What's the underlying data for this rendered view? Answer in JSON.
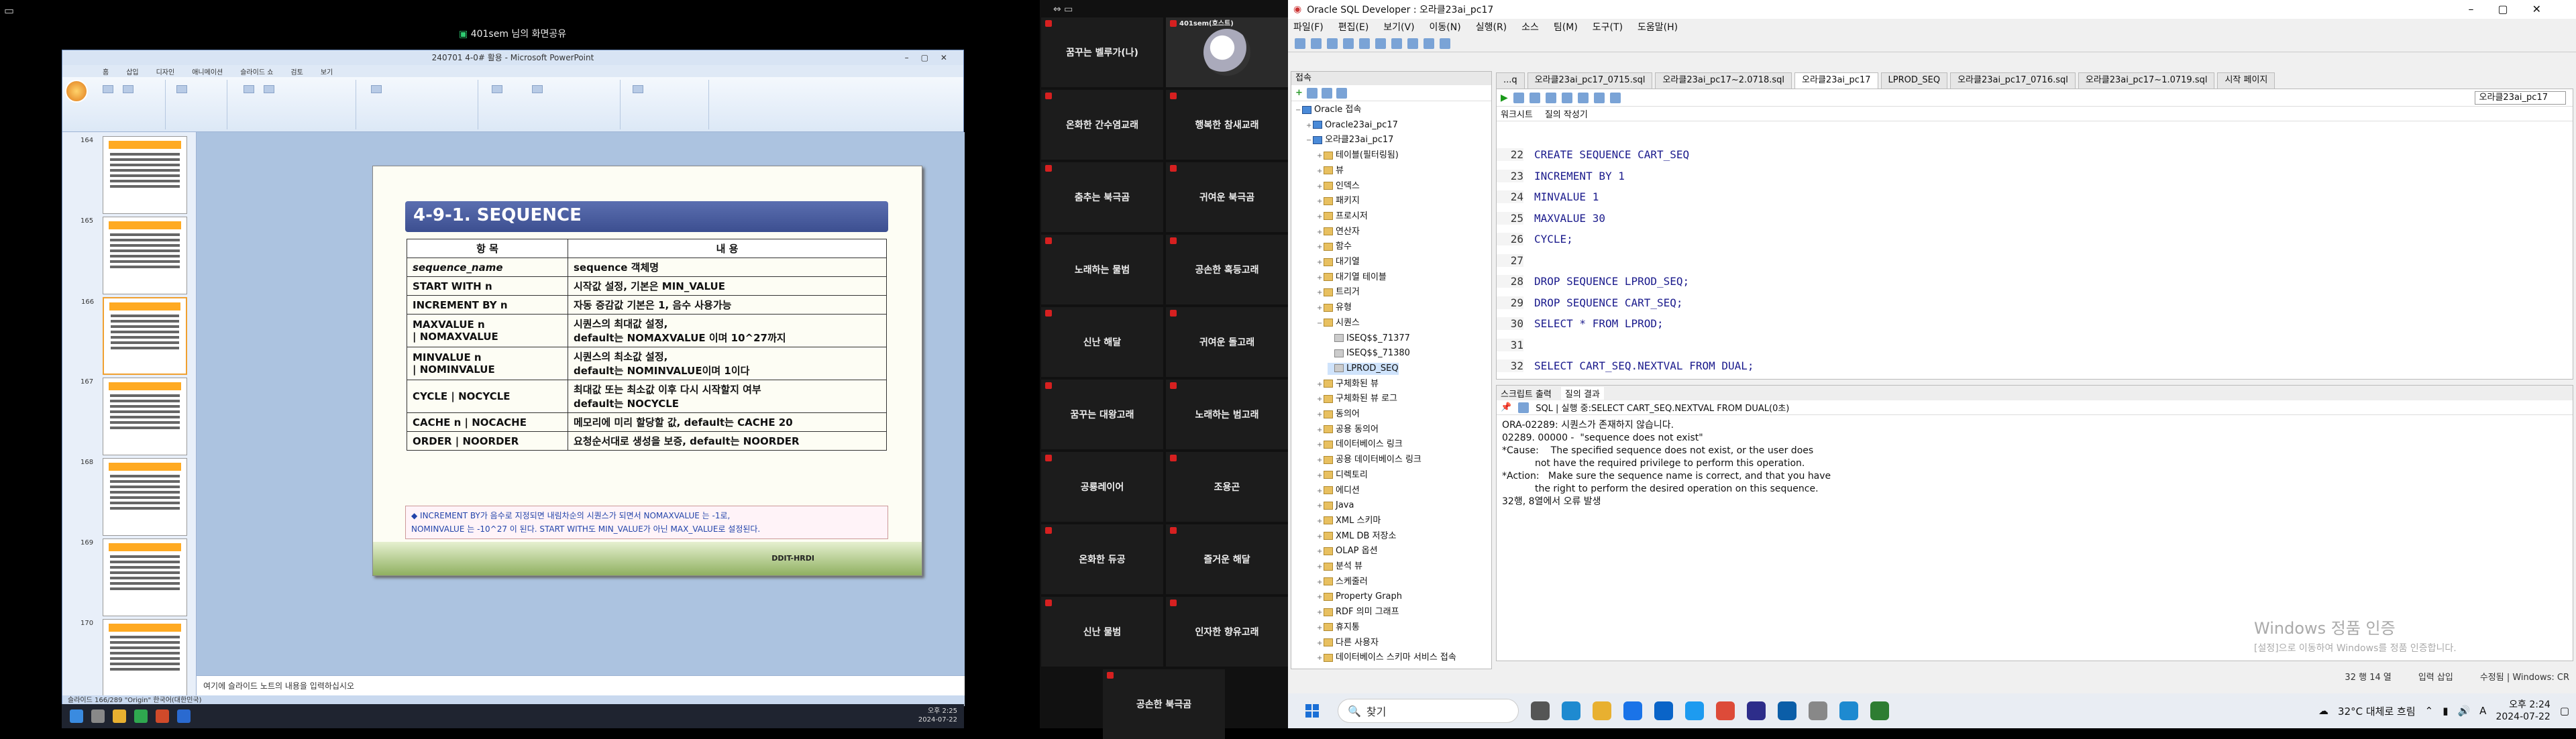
{
  "share": {
    "label": "401sem 님의 화면공유"
  },
  "ppt": {
    "window_title": "240701 4-0# 활용 - Microsoft PowerPoint",
    "tabs": [
      "홈",
      "삽입",
      "디자인",
      "애니메이션",
      "슬라이드 쇼",
      "검토",
      "보기"
    ],
    "notes_placeholder": "여기에 슬라이드 노트의 내용을 입력하십시오",
    "status": "슬라이드 166/289   \"Origin\"   한국어(대한민국)",
    "thumbnail_numbers": [
      "164",
      "165",
      "166",
      "167",
      "168",
      "169",
      "170"
    ],
    "slide": {
      "title": "4-9-1. SEQUENCE",
      "header": [
        "항 목",
        "내 용"
      ],
      "rows": [
        {
          "k": "sequence_name",
          "v": "sequence 객체명"
        },
        {
          "k": "START WITH  n",
          "v": "시작값 설정,  기본은 MIN_VALUE"
        },
        {
          "k": "INCREMENT BY  n",
          "v": "자동 증감값 기본은 1, 음수 사용가능"
        },
        {
          "k": "MAXVALUE n\n    | NOMAXVALUE",
          "v": "시퀀스의 최대값 설정,\ndefault는 NOMAXVALUE 이며 10^27까지"
        },
        {
          "k": "MINVALUE  n\n    | NOMINVALUE",
          "v": "시퀀스의 최소값 설정,\ndefault는 NOMINVALUE이며 1이다"
        },
        {
          "k": "CYCLE    | NOCYCLE",
          "v": "최대값 또는 최소값 이후 다시 시작할지 여부\ndefault는 NOCYCLE"
        },
        {
          "k": "CACHE n   | NOCACHE",
          "v": "메모리에 미리 할당할 값, default는 CACHE 20"
        },
        {
          "k": "ORDER     | NOORDER",
          "v": "요청순서대로 생성을 보증, default는 NOORDER"
        }
      ],
      "note": "◆ INCREMENT BY가 음수로 지정되면 내림차순의 시퀀스가 되면서 NOMAXVALUE 는 -1로,\n   NOMINVALUE 는 -10^27 이 된다. START WITH도 MIN_VALUE가 아닌 MAX_VALUE로 설정된다.",
      "footer": "DDIT-HRDI"
    },
    "clock": {
      "time": "오후 2:25",
      "date": "2024-07-22"
    }
  },
  "participants": {
    "me": "401sem(호스트)",
    "tiles": [
      "꿈꾸는 벨루가(나)",
      "",
      "온화한 간수염교래",
      "행복한 참새교래",
      "춤추는 북극곰",
      "귀여운 북극곰",
      "노래하는 물범",
      "공손한 혹등고래",
      "신난 해달",
      "귀여운 돌고래",
      "꿈꾸는 대왕고래",
      "노래하는 범고래",
      "공룡레이어",
      "조용곤",
      "온화한 듀공",
      "즐거운 해달",
      "신난 물범",
      "인자한 향유고래"
    ],
    "last": "공손한 북극곰"
  },
  "sqldev": {
    "title": "Oracle SQL Developer : 오라클23ai_pc17",
    "menu": [
      "파일(F)",
      "편집(E)",
      "보기(V)",
      "이동(N)",
      "실행(R)",
      "소스",
      "팀(M)",
      "도구(T)",
      "도움말(H)"
    ],
    "conn_panel_title": "접속",
    "tree": [
      {
        "d": 0,
        "t": "Oracle 접속",
        "i": "db",
        "pm": "−"
      },
      {
        "d": 1,
        "t": "Oracle23ai_pc17",
        "i": "db",
        "pm": "+"
      },
      {
        "d": 1,
        "t": "오라클23ai_pc17",
        "i": "db",
        "pm": "−"
      },
      {
        "d": 2,
        "t": "테이블(필터링됨)",
        "i": "f",
        "pm": "+"
      },
      {
        "d": 2,
        "t": "뷰",
        "i": "f",
        "pm": "+"
      },
      {
        "d": 2,
        "t": "인덱스",
        "i": "f",
        "pm": "+"
      },
      {
        "d": 2,
        "t": "패키지",
        "i": "f",
        "pm": "+"
      },
      {
        "d": 2,
        "t": "프로시저",
        "i": "f",
        "pm": "+"
      },
      {
        "d": 2,
        "t": "연산자",
        "i": "f",
        "pm": "+"
      },
      {
        "d": 2,
        "t": "함수",
        "i": "f",
        "pm": "+"
      },
      {
        "d": 2,
        "t": "대기열",
        "i": "f",
        "pm": "+"
      },
      {
        "d": 2,
        "t": "대기열 테이블",
        "i": "f",
        "pm": "+"
      },
      {
        "d": 2,
        "t": "트리거",
        "i": "f",
        "pm": "+"
      },
      {
        "d": 2,
        "t": "유형",
        "i": "f",
        "pm": "+"
      },
      {
        "d": 2,
        "t": "시퀀스",
        "i": "f",
        "pm": "−"
      },
      {
        "d": 3,
        "t": "ISEQ$$_71377",
        "i": "seq",
        "pm": ""
      },
      {
        "d": 3,
        "t": "ISEQ$$_71380",
        "i": "seq",
        "pm": ""
      },
      {
        "d": 3,
        "t": "LPROD_SEQ",
        "i": "seq",
        "pm": ""
      },
      {
        "d": 2,
        "t": "구체화된 뷰",
        "i": "f",
        "pm": "+"
      },
      {
        "d": 2,
        "t": "구체화된 뷰 로그",
        "i": "f",
        "pm": "+"
      },
      {
        "d": 2,
        "t": "동의어",
        "i": "f",
        "pm": "+"
      },
      {
        "d": 2,
        "t": "공용 동의어",
        "i": "f",
        "pm": "+"
      },
      {
        "d": 2,
        "t": "데이터베이스 링크",
        "i": "f",
        "pm": "+"
      },
      {
        "d": 2,
        "t": "공용 데이터베이스 링크",
        "i": "f",
        "pm": "+"
      },
      {
        "d": 2,
        "t": "디렉토리",
        "i": "f",
        "pm": "+"
      },
      {
        "d": 2,
        "t": "에디션",
        "i": "f",
        "pm": "+"
      },
      {
        "d": 2,
        "t": "Java",
        "i": "f",
        "pm": "+"
      },
      {
        "d": 2,
        "t": "XML 스키마",
        "i": "f",
        "pm": "+"
      },
      {
        "d": 2,
        "t": "XML DB 저장소",
        "i": "f",
        "pm": "+"
      },
      {
        "d": 2,
        "t": "OLAP 옵션",
        "i": "f",
        "pm": "+"
      },
      {
        "d": 2,
        "t": "분석 뷰",
        "i": "f",
        "pm": "+"
      },
      {
        "d": 2,
        "t": "스케줄러",
        "i": "f",
        "pm": "+"
      },
      {
        "d": 2,
        "t": "Property Graph",
        "i": "f",
        "pm": "+"
      },
      {
        "d": 2,
        "t": "RDF 의미 그래프",
        "i": "f",
        "pm": "+"
      },
      {
        "d": 2,
        "t": "휴지통",
        "i": "f",
        "pm": "+"
      },
      {
        "d": 2,
        "t": "다른 사용자",
        "i": "f",
        "pm": "+"
      },
      {
        "d": 2,
        "t": "데이터베이스 스키마 서비스 접속",
        "i": "f",
        "pm": "+"
      }
    ],
    "editor_tabs": [
      "...q",
      "오라클23ai_pc17_0715.sql",
      "오라클23ai_pc17~2.0718.sql",
      "오라클23ai_pc17",
      "LPROD_SEQ",
      "오라클23ai_pc17_0716.sql",
      "오라클23ai_pc17~1.0719.sql",
      "시작 페이지"
    ],
    "active_tab": 3,
    "sub_tabs": [
      "워크시트",
      "질의 작성기"
    ],
    "connection": "오라클23ai_pc17",
    "code": [
      {
        "n": "22",
        "t": "CREATE SEQUENCE CART_SEQ"
      },
      {
        "n": "23",
        "t": "INCREMENT BY 1"
      },
      {
        "n": "24",
        "t": "MINVALUE 1"
      },
      {
        "n": "25",
        "t": "MAXVALUE 30"
      },
      {
        "n": "26",
        "t": "CYCLE;"
      },
      {
        "n": "27",
        "t": ""
      },
      {
        "n": "28",
        "t": "DROP SEQUENCE LPROD_SEQ;"
      },
      {
        "n": "29",
        "t": "DROP SEQUENCE CART_SEQ;"
      },
      {
        "n": "30",
        "t": "SELECT * FROM LPROD;"
      },
      {
        "n": "31",
        "t": ""
      },
      {
        "n": "32",
        "t": "SELECT CART_SEQ.NEXTVAL FROM DUAL;"
      }
    ],
    "result_tabs": [
      "스크립트 출력",
      "질의 결과"
    ],
    "result_tool_text": "SQL | 실행 중:SELECT CART_SEQ.NEXTVAL FROM DUAL(0초)",
    "result_output": "ORA-02289: 시퀀스가 존재하지 않습니다.\n02289. 00000 -  \"sequence does not exist\"\n*Cause:    The specified sequence does not exist, or the user does\n           not have the required privilege to perform this operation.\n*Action:   Make sure the sequence name is correct, and that you have\n           the right to perform the desired operation on this sequence.\n32행, 8열에서 오류 발생",
    "activate": {
      "line1": "Windows 정품 인증",
      "line2": "[설정]으로 이동하여 Windows를 정품 인증합니다."
    },
    "status": [
      "32 행 14 열",
      "입력 삽입",
      "수정됨 | Windows: CR"
    ]
  },
  "taskbar": {
    "search_placeholder": "찾기",
    "weather": "32°C 대체로 흐림",
    "time": "오후 2:24",
    "date": "2024-07-22",
    "lang": "A"
  }
}
